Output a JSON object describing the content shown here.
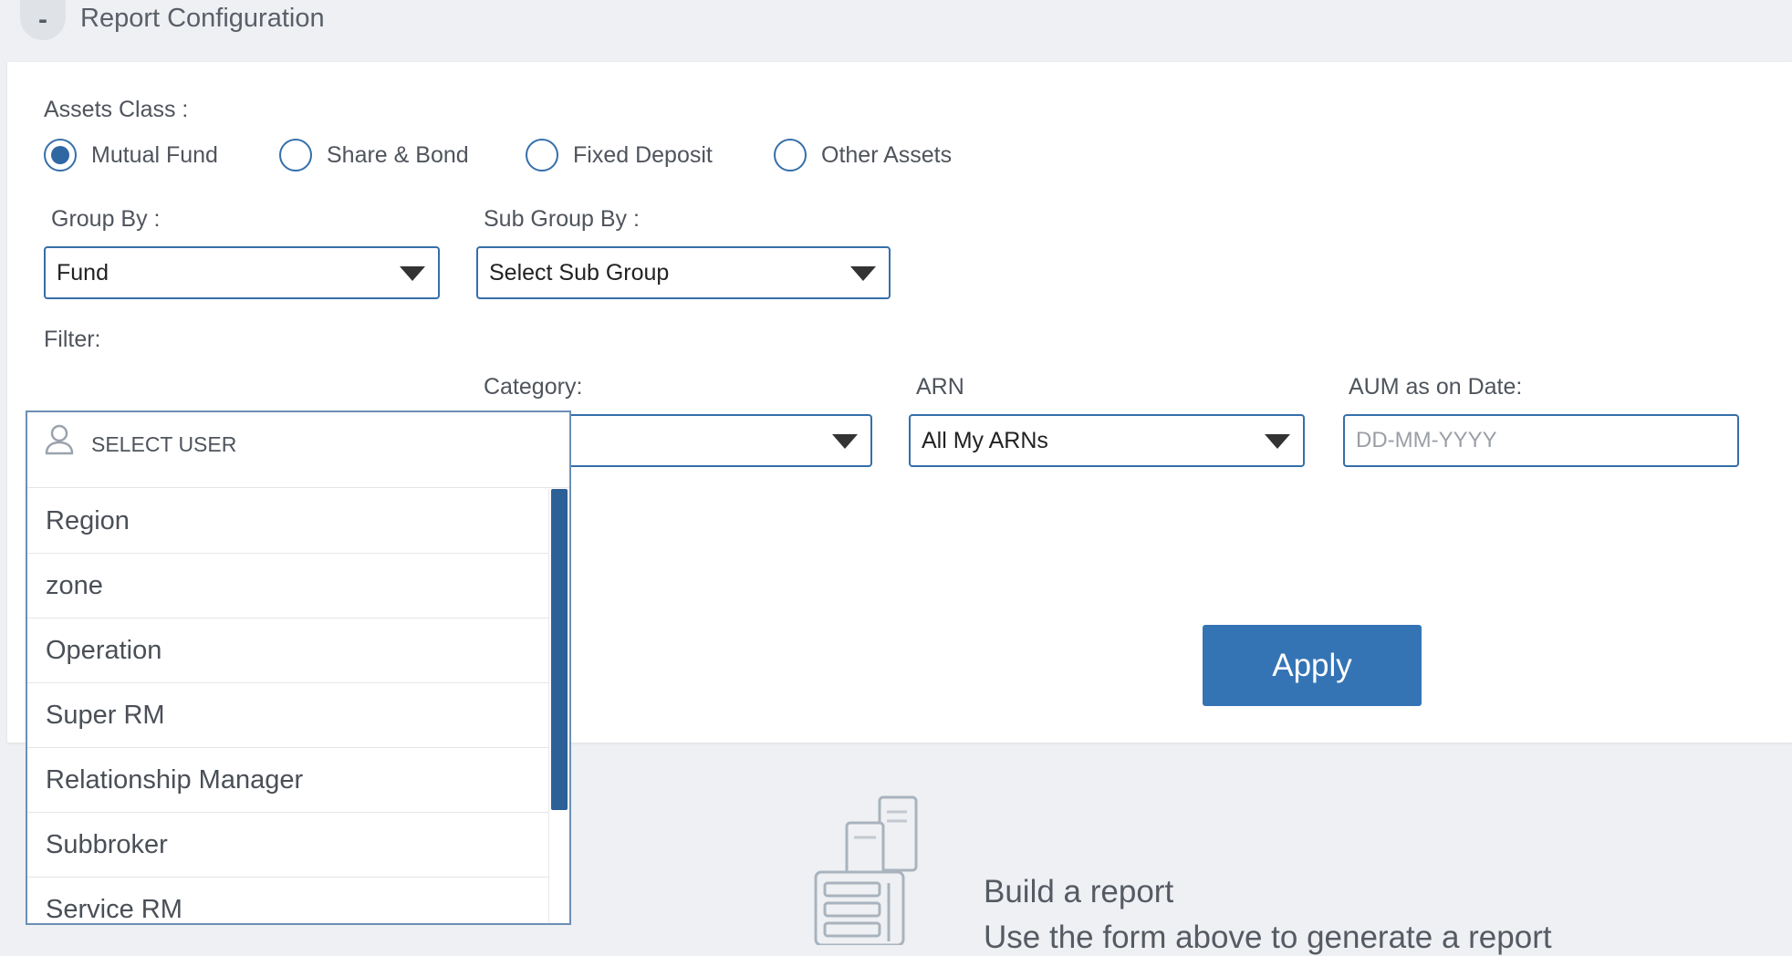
{
  "header": {
    "collapse_symbol": "-",
    "title": "Report Configuration"
  },
  "assets_class": {
    "label": "Assets Class :",
    "options": [
      {
        "label": "Mutual Fund",
        "selected": true
      },
      {
        "label": "Share & Bond",
        "selected": false
      },
      {
        "label": "Fixed Deposit",
        "selected": false
      },
      {
        "label": "Other Assets",
        "selected": false
      }
    ]
  },
  "group_by": {
    "label": "Group By :",
    "value": "Fund"
  },
  "sub_group_by": {
    "label": "Sub Group By :",
    "value": "Select Sub Group"
  },
  "filter": {
    "label": "Filter:",
    "category": {
      "label": "Category:",
      "value": ""
    },
    "arn": {
      "label": "ARN",
      "value": "All My ARNs"
    },
    "aum_date": {
      "label": "AUM as on Date:",
      "placeholder": "DD-MM-YYYY"
    }
  },
  "apply_label": "Apply",
  "user_dropdown": {
    "search_placeholder": "SELECT USER",
    "items": [
      "Region",
      "zone",
      "Operation",
      "Super RM",
      "Relationship Manager",
      "Subbroker",
      "Service RM"
    ]
  },
  "empty_state": {
    "title": "Build a report",
    "subtitle": "Use the form above to generate a report"
  },
  "colors": {
    "accent": "#3574b4",
    "border": "#356fa9",
    "background": "#eef0f3",
    "scrollbar": "#2d6096"
  }
}
